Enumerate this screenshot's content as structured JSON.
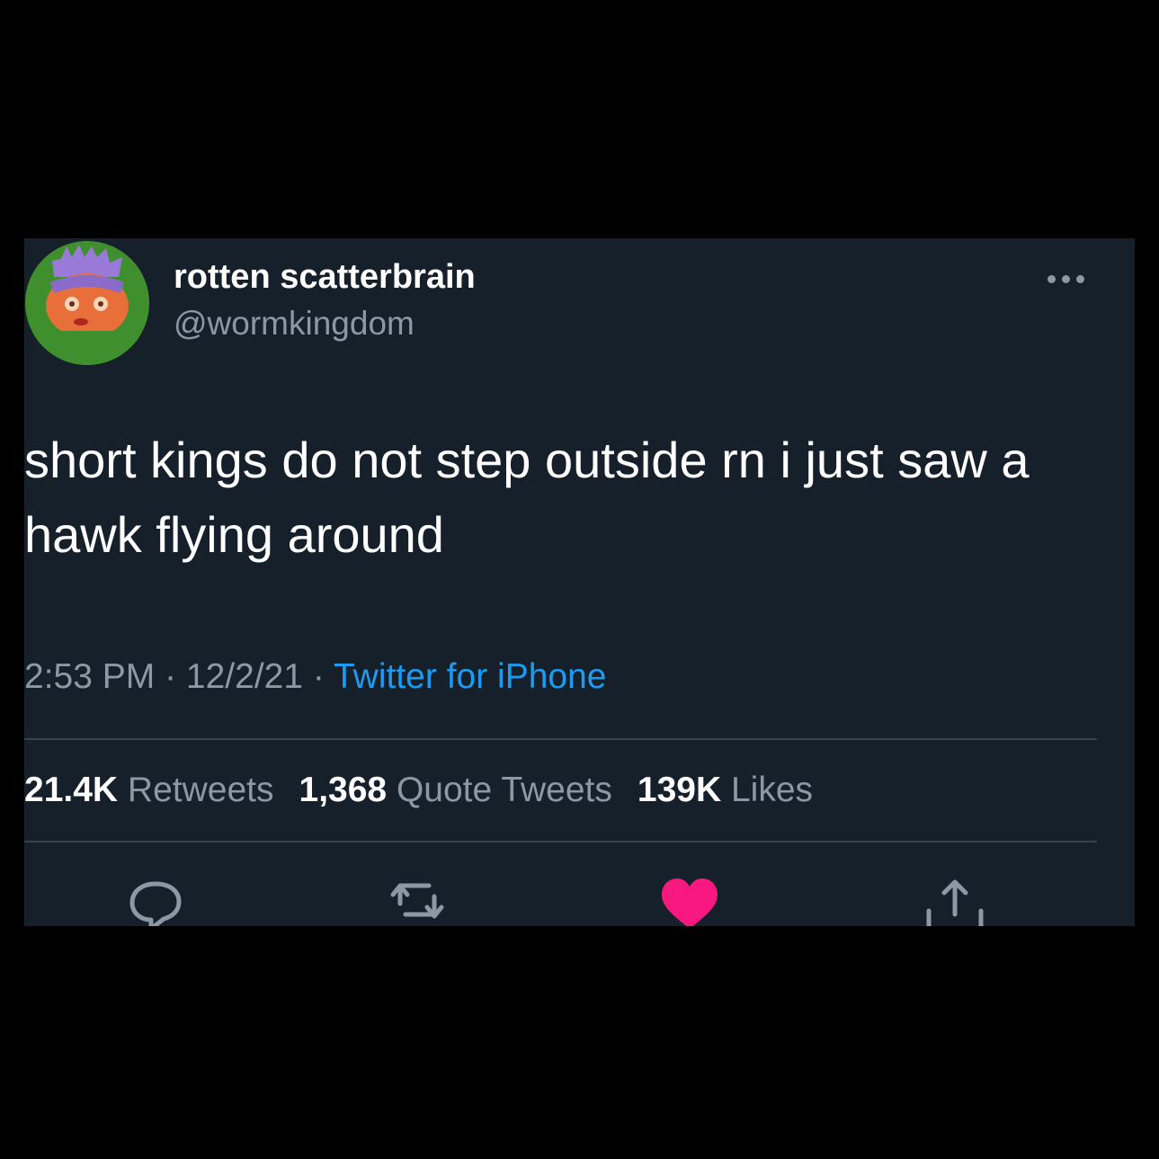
{
  "tweet": {
    "author": {
      "display_name": "rotten scatterbrain",
      "handle": "@wormkingdom"
    },
    "text": "short kings do not step outside rn i just saw a hawk flying around",
    "time": "2:53 PM",
    "date": "12/2/21",
    "separator": " · ",
    "source": "Twitter for iPhone",
    "stats": {
      "retweets_count": "21.4K",
      "retweets_label": "Retweets",
      "quote_count": "1,368",
      "quote_label": "Quote Tweets",
      "likes_count": "139K",
      "likes_label": "Likes"
    },
    "actions": [
      "reply-icon",
      "retweet-icon",
      "like-icon",
      "share-icon"
    ],
    "liked": true
  },
  "colors": {
    "background": "#15202b",
    "text": "#ffffff",
    "secondary": "#8b98a5",
    "link": "#1d9bf0",
    "like": "#f91880"
  }
}
